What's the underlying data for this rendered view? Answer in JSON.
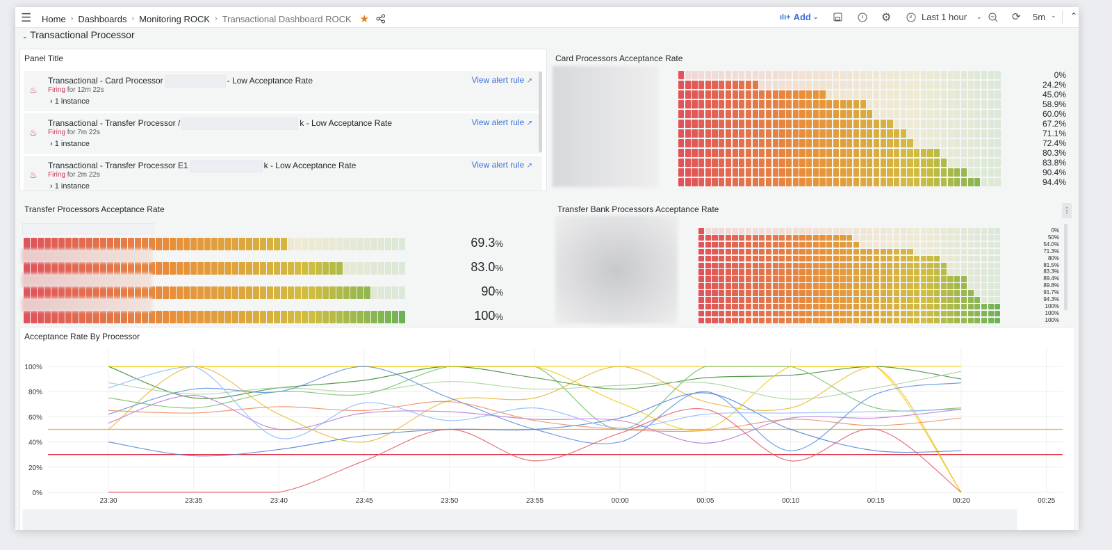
{
  "topbar": {
    "breadcrumb": [
      "Home",
      "Dashboards",
      "Monitoring ROCK"
    ],
    "current": "Transactional Dashboard ROCK",
    "add_label": "Add",
    "time_range": "Last 1 hour",
    "refresh_interval": "5m"
  },
  "row": {
    "title": "Transactional Processor"
  },
  "alerts_panel": {
    "title": "Panel Title",
    "items": [
      {
        "title_prefix": "Transactional - Card Processor",
        "title_suffix": "- Low Acceptance Rate",
        "state": "Firing",
        "duration": "for 12m 22s",
        "instances": "1 instance",
        "link": "View alert rule"
      },
      {
        "title_prefix": "Transactional - Transfer Processor /",
        "title_suffix": "k - Low Acceptance Rate",
        "state": "Firing",
        "duration": "for 7m 22s",
        "instances": "1 instance",
        "link": "View alert rule"
      },
      {
        "title_prefix": "Transactional - Transfer Processor E1",
        "title_suffix": "k - Low Acceptance Rate",
        "state": "Firing",
        "duration": "for 2m 22s",
        "instances": "1 instance",
        "link": "View alert rule"
      }
    ]
  },
  "card_panel": {
    "title": "Card Processors Acceptance Rate",
    "values": [
      0,
      24.2,
      45.0,
      58.9,
      60.0,
      67.2,
      71.1,
      72.4,
      80.3,
      83.8,
      90.4,
      94.4
    ],
    "labels": [
      "0%",
      "24.2%",
      "45.0%",
      "58.9%",
      "60.0%",
      "67.2%",
      "71.1%",
      "72.4%",
      "80.3%",
      "83.8%",
      "90.4%",
      "94.4%"
    ]
  },
  "transfer_panel": {
    "title": "Transfer Processors Acceptance Rate",
    "values": [
      69.3,
      83.0,
      90,
      100
    ],
    "labels": [
      "69.3",
      "83.0",
      "90",
      "100"
    ],
    "unit": "%"
  },
  "bank_panel": {
    "title": "Transfer Bank Processors Acceptance Rate",
    "values": [
      0,
      50,
      54.0,
      71.3,
      80,
      81.5,
      83.3,
      89.4,
      89.8,
      91.7,
      94.3,
      100,
      100,
      100
    ],
    "labels": [
      "0%",
      "50%",
      "54.0%",
      "71.3%",
      "80%",
      "81.5%",
      "83.3%",
      "89.4%",
      "89.8%",
      "91.7%",
      "94.3%",
      "100%",
      "100%",
      "100%"
    ]
  },
  "gauge_colors": {
    "low": "#e0535a",
    "mid": "#e8913a",
    "high": "#d1bd40",
    "top": "#6db356"
  },
  "chart_data": {
    "type": "line",
    "title": "Acceptance Rate By Processor",
    "x": [
      "23:30",
      "23:35",
      "23:40",
      "23:45",
      "23:50",
      "23:55",
      "00:00",
      "00:05",
      "00:10",
      "00:15",
      "00:20"
    ],
    "x_ticks": [
      "23:30",
      "23:35",
      "23:40",
      "23:45",
      "23:50",
      "23:55",
      "00:00",
      "00:05",
      "00:10",
      "00:15",
      "00:20",
      "00:25"
    ],
    "y_ticks": [
      "0%",
      "20%",
      "40%",
      "60%",
      "80%",
      "100%"
    ],
    "ylim": [
      0,
      100
    ],
    "grid": true,
    "thresholds": [
      {
        "value": 50,
        "color": "#e8b730"
      },
      {
        "value": 30,
        "color": "#e02f44"
      }
    ],
    "series": [
      {
        "color": "#f2cc0c",
        "values": [
          100,
          100,
          100,
          100,
          100,
          100,
          100,
          100,
          100,
          100,
          100
        ]
      },
      {
        "color": "#37872d",
        "values": [
          100,
          75,
          83,
          89,
          100,
          91,
          82,
          91,
          93,
          100,
          90
        ]
      },
      {
        "color": "#73bf69",
        "values": [
          75,
          67,
          80,
          78,
          100,
          100,
          50,
          100,
          100,
          67,
          67
        ]
      },
      {
        "color": "#a8d19e",
        "values": [
          87,
          78,
          83,
          80,
          88,
          82,
          85,
          87,
          74,
          83,
          96
        ]
      },
      {
        "color": "#e8b730",
        "values": [
          50,
          100,
          62,
          40,
          73,
          75,
          100,
          72,
          67,
          100,
          0
        ]
      },
      {
        "color": "#f2cc0c",
        "values": [
          100,
          100,
          100,
          100,
          100,
          100,
          71,
          50,
          100,
          100,
          0
        ]
      },
      {
        "color": "#5a8ee0",
        "values": [
          62,
          82,
          80,
          100,
          75,
          50,
          40,
          80,
          33,
          78,
          87
        ]
      },
      {
        "color": "#4f7fd6",
        "values": [
          40,
          29,
          34,
          45,
          50,
          50,
          59,
          79,
          50,
          33,
          33
        ]
      },
      {
        "color": "#8ab8ff",
        "values": [
          83,
          100,
          43,
          71,
          57,
          67,
          51,
          62,
          63,
          64,
          66
        ]
      },
      {
        "color": "#b877d9",
        "values": [
          55,
          77,
          50,
          63,
          64,
          58,
          57,
          39,
          59,
          59,
          66
        ]
      },
      {
        "color": "#f08a5d",
        "values": [
          65,
          63,
          68,
          65,
          72,
          57,
          50,
          49,
          58,
          53,
          59
        ]
      },
      {
        "color": "#e05a6a",
        "values": [
          0,
          0,
          0,
          25,
          50,
          25,
          47,
          66,
          25,
          50,
          0
        ]
      }
    ]
  }
}
